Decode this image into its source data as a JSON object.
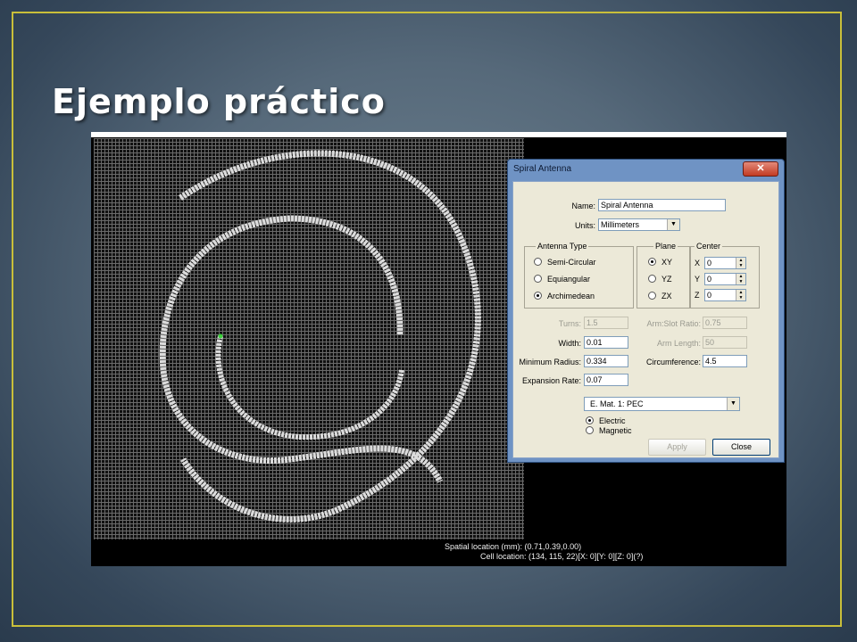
{
  "slide": {
    "title": "Ejemplo práctico"
  },
  "status": {
    "spatial": "Spatial location (mm): (0.71,0.39,0.00)",
    "cell": "Cell location: (134, 115, 22)[X: 0][Y: 0][Z: 0](?)"
  },
  "dialog": {
    "title": "Spiral Antenna",
    "close_glyph": "✕",
    "name_label": "Name:",
    "name_value": "Spiral Antenna",
    "units_label": "Units:",
    "units_value": "Millimeters",
    "antenna_type": {
      "label": "Antenna Type",
      "options": [
        "Semi-Circular",
        "Equiangular",
        "Archimedean"
      ],
      "selected": "Archimedean"
    },
    "plane": {
      "label": "Plane",
      "options": [
        "XY",
        "YZ",
        "ZX"
      ],
      "selected": "XY"
    },
    "center": {
      "label": "Center",
      "x_label": "X",
      "x_value": "0",
      "y_label": "Y",
      "y_value": "0",
      "z_label": "Z",
      "z_value": "0"
    },
    "turns_label": "Turns:",
    "turns_value": "1.5",
    "arm_slot_label": "Arm:Slot Ratio:",
    "arm_slot_value": "0.75",
    "width_label": "Width:",
    "width_value": "0.01",
    "arm_length_label": "Arm Length:",
    "arm_length_value": "50",
    "min_radius_label": "Minimum Radius:",
    "min_radius_value": "0.334",
    "circumference_label": "Circumference:",
    "circumference_value": "4.5",
    "expansion_label": "Expansion Rate:",
    "expansion_value": "0.07",
    "material_value": "E. Mat. 1: PEC",
    "material_type": {
      "options": [
        "Electric",
        "Magnetic"
      ],
      "selected": "Electric"
    },
    "apply_label": "Apply",
    "close_label": "Close"
  },
  "icons": {
    "dropdown": "chevron-down-icon",
    "spinner": "spinner-arrows-icon",
    "close": "close-icon"
  }
}
